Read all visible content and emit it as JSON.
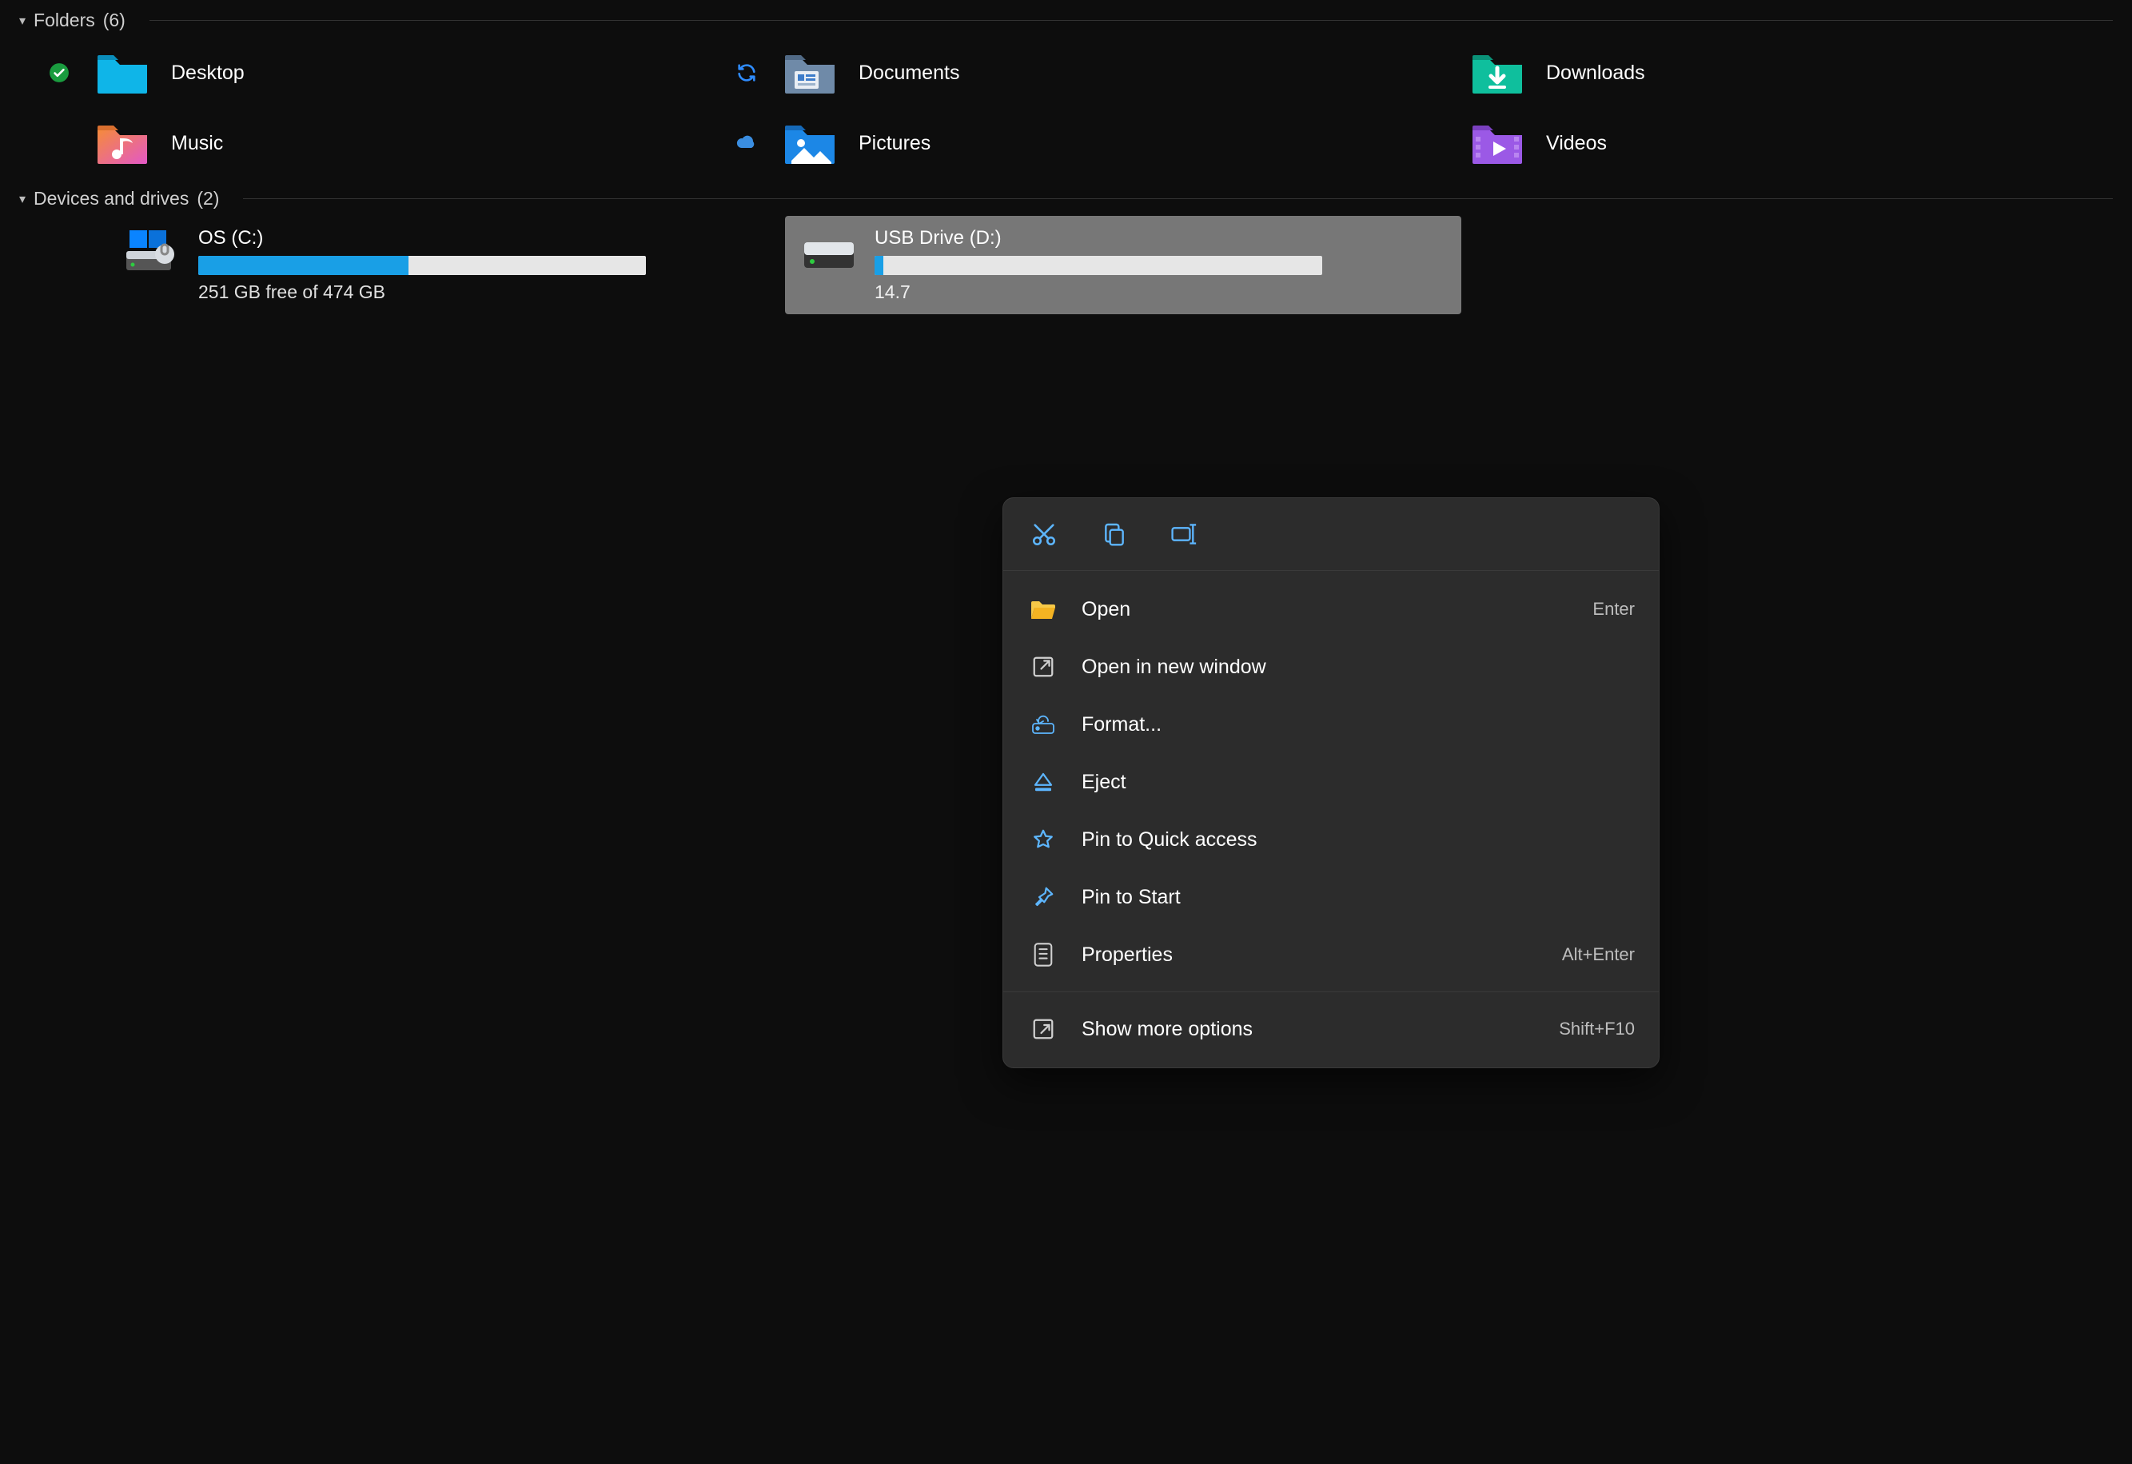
{
  "sections": {
    "folders": {
      "title": "Folders",
      "count": "(6)"
    },
    "drives": {
      "title": "Devices and drives",
      "count": "(2)"
    }
  },
  "folders": [
    {
      "label": "Desktop",
      "status": "synced"
    },
    {
      "label": "Documents",
      "status": "sync"
    },
    {
      "label": "Downloads",
      "status": ""
    },
    {
      "label": "Music",
      "status": ""
    },
    {
      "label": "Pictures",
      "status": "cloud"
    },
    {
      "label": "Videos",
      "status": ""
    }
  ],
  "drives": [
    {
      "name": "OS (C:)",
      "free_text": "251 GB free of 474 GB",
      "fill_percent": 47,
      "selected": false
    },
    {
      "name": "USB Drive (D:)",
      "free_text": "14.7",
      "fill_percent": 2,
      "selected": true
    }
  ],
  "context_menu": {
    "items": [
      {
        "label": "Open",
        "accel": "Enter"
      },
      {
        "label": "Open in new window",
        "accel": ""
      },
      {
        "label": "Format...",
        "accel": ""
      },
      {
        "label": "Eject",
        "accel": ""
      },
      {
        "label": "Pin to Quick access",
        "accel": ""
      },
      {
        "label": "Pin to Start",
        "accel": ""
      },
      {
        "label": "Properties",
        "accel": "Alt+Enter"
      },
      {
        "label": "Show more options",
        "accel": "Shift+F10"
      }
    ]
  }
}
